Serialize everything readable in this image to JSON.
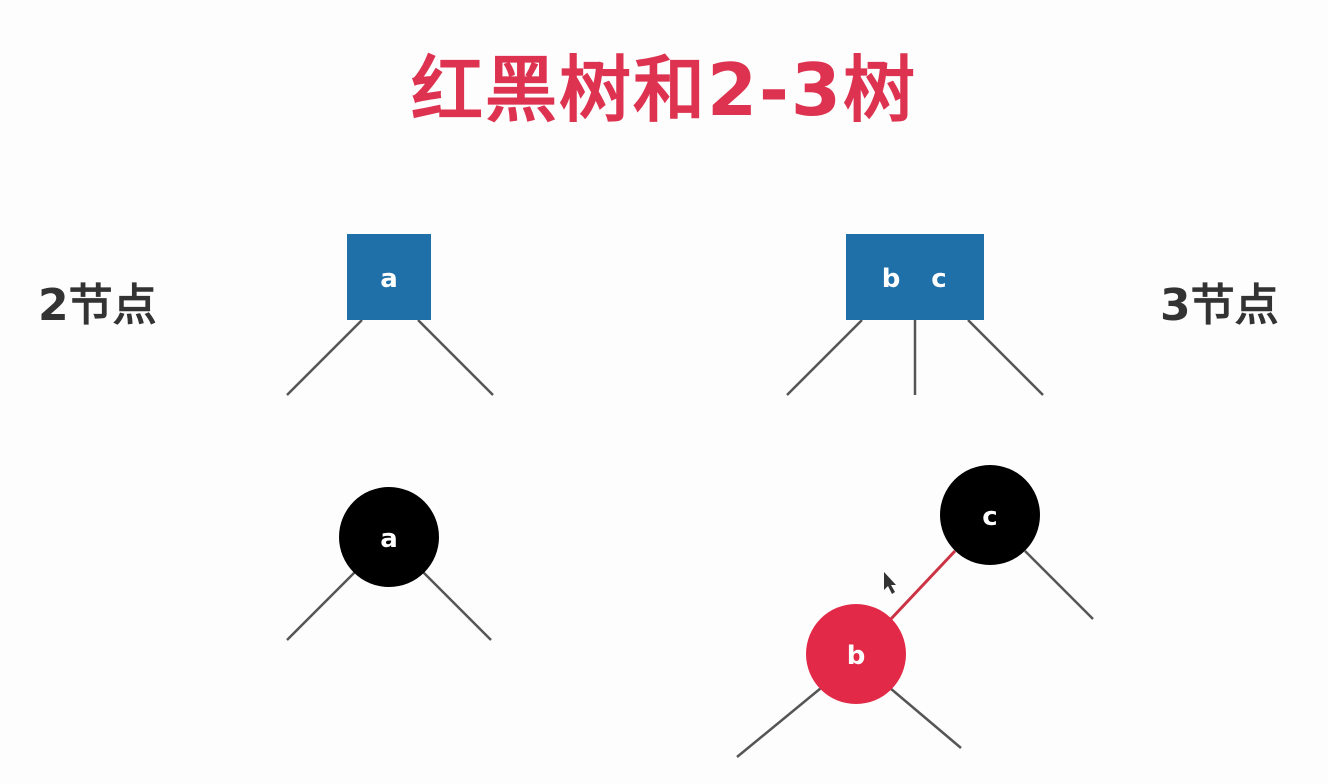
{
  "title": "红黑树和2-3树",
  "labels": {
    "left": "2节点",
    "right": "3节点"
  },
  "two_node": {
    "key": "a"
  },
  "three_node": {
    "keys": [
      "b",
      "c"
    ]
  },
  "rb_two_node": {
    "key": "a",
    "color": "black"
  },
  "rb_three_node": {
    "parent": {
      "key": "c",
      "color": "black"
    },
    "child": {
      "key": "b",
      "color": "red"
    }
  },
  "colors": {
    "title": "#dd3350",
    "box": "#1f6fa8",
    "black_node": "#000000",
    "red_node": "#e22a48",
    "red_link": "#cc3344",
    "edge": "#555555"
  }
}
